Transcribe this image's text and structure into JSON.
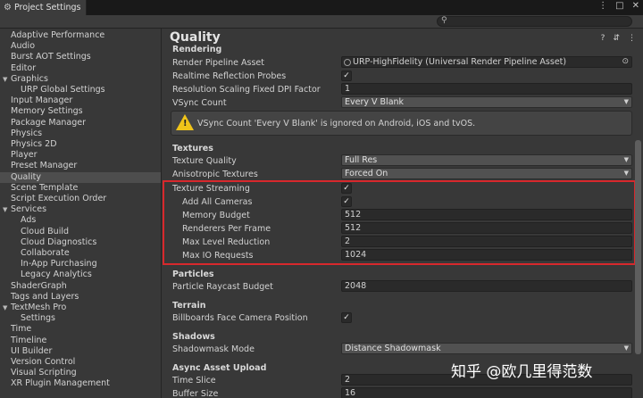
{
  "window": {
    "tab_title": "Project Settings",
    "controls": [
      "⋮",
      "□",
      "✕"
    ]
  },
  "search": {
    "placeholder": ""
  },
  "sidebar": {
    "items": [
      {
        "label": "Adaptive Performance",
        "indent": 0,
        "arrow": ""
      },
      {
        "label": "Audio",
        "indent": 0,
        "arrow": ""
      },
      {
        "label": "Burst AOT Settings",
        "indent": 0,
        "arrow": ""
      },
      {
        "label": "Editor",
        "indent": 0,
        "arrow": ""
      },
      {
        "label": "Graphics",
        "indent": 0,
        "arrow": "▼"
      },
      {
        "label": "URP Global Settings",
        "indent": 1,
        "arrow": ""
      },
      {
        "label": "Input Manager",
        "indent": 0,
        "arrow": ""
      },
      {
        "label": "Memory Settings",
        "indent": 0,
        "arrow": ""
      },
      {
        "label": "Package Manager",
        "indent": 0,
        "arrow": ""
      },
      {
        "label": "Physics",
        "indent": 0,
        "arrow": ""
      },
      {
        "label": "Physics 2D",
        "indent": 0,
        "arrow": ""
      },
      {
        "label": "Player",
        "indent": 0,
        "arrow": ""
      },
      {
        "label": "Preset Manager",
        "indent": 0,
        "arrow": ""
      },
      {
        "label": "Quality",
        "indent": 0,
        "arrow": "",
        "selected": true
      },
      {
        "label": "Scene Template",
        "indent": 0,
        "arrow": ""
      },
      {
        "label": "Script Execution Order",
        "indent": 0,
        "arrow": ""
      },
      {
        "label": "Services",
        "indent": 0,
        "arrow": "▼"
      },
      {
        "label": "Ads",
        "indent": 1,
        "arrow": ""
      },
      {
        "label": "Cloud Build",
        "indent": 1,
        "arrow": ""
      },
      {
        "label": "Cloud Diagnostics",
        "indent": 1,
        "arrow": ""
      },
      {
        "label": "Collaborate",
        "indent": 1,
        "arrow": ""
      },
      {
        "label": "In-App Purchasing",
        "indent": 1,
        "arrow": ""
      },
      {
        "label": "Legacy Analytics",
        "indent": 1,
        "arrow": ""
      },
      {
        "label": "ShaderGraph",
        "indent": 0,
        "arrow": ""
      },
      {
        "label": "Tags and Layers",
        "indent": 0,
        "arrow": ""
      },
      {
        "label": "TextMesh Pro",
        "indent": 0,
        "arrow": "▼"
      },
      {
        "label": "Settings",
        "indent": 1,
        "arrow": ""
      },
      {
        "label": "Time",
        "indent": 0,
        "arrow": ""
      },
      {
        "label": "Timeline",
        "indent": 0,
        "arrow": ""
      },
      {
        "label": "UI Builder",
        "indent": 0,
        "arrow": ""
      },
      {
        "label": "Version Control",
        "indent": 0,
        "arrow": ""
      },
      {
        "label": "Visual Scripting",
        "indent": 0,
        "arrow": ""
      },
      {
        "label": "XR Plugin Management",
        "indent": 0,
        "arrow": ""
      }
    ]
  },
  "main": {
    "title": "Quality",
    "header_icons": [
      "?",
      "⇵",
      "⋮"
    ],
    "rendering": {
      "section": "Rendering",
      "pipeline_label": "Render Pipeline Asset",
      "pipeline_value": "URP-HighFidelity (Universal Render Pipeline Asset)",
      "rtprobes_label": "Realtime Reflection Probes",
      "rtprobes_checked": true,
      "dpi_label": "Resolution Scaling Fixed DPI Factor",
      "dpi_value": "1",
      "vsync_label": "VSync Count",
      "vsync_value": "Every V Blank",
      "warning": "VSync Count 'Every V Blank' is ignored on Android, iOS and tvOS."
    },
    "textures": {
      "section": "Textures",
      "quality_label": "Texture Quality",
      "quality_value": "Full Res",
      "aniso_label": "Anisotropic Textures",
      "aniso_value": "Forced On",
      "streaming_label": "Texture Streaming",
      "streaming_checked": true,
      "add_cams_label": "Add All Cameras",
      "add_cams_checked": true,
      "mem_label": "Memory Budget",
      "mem_value": "512",
      "rpf_label": "Renderers Per Frame",
      "rpf_value": "512",
      "mlr_label": "Max Level Reduction",
      "mlr_value": "2",
      "io_label": "Max IO Requests",
      "io_value": "1024"
    },
    "particles": {
      "section": "Particles",
      "budget_label": "Particle Raycast Budget",
      "budget_value": "2048"
    },
    "terrain": {
      "section": "Terrain",
      "billboard_label": "Billboards Face Camera Position",
      "billboard_checked": true
    },
    "shadows": {
      "section": "Shadows",
      "mode_label": "Shadowmask Mode",
      "mode_value": "Distance Shadowmask"
    },
    "async": {
      "section": "Async Asset Upload",
      "slice_label": "Time Slice",
      "slice_value": "2",
      "buffer_label": "Buffer Size",
      "buffer_value": "16"
    }
  },
  "watermark": "知乎 @欧几里得范数",
  "colors": {
    "highlight_border": "#d8282c",
    "warning_icon": "#f0c419",
    "selection": "#4d4d4d"
  }
}
